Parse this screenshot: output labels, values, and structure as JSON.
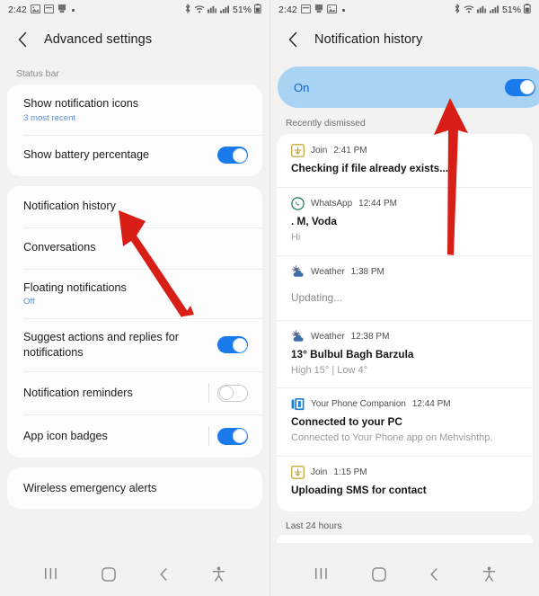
{
  "status_bar": {
    "time": "2:42",
    "left_icons": [
      "image-icon",
      "calendar-icon",
      "app-icon",
      "dot-icon"
    ],
    "right_icons": [
      "bluetooth-icon",
      "wifi-icon",
      "network-icon",
      "signal-icon"
    ],
    "battery_percent": "51%",
    "battery_icon": "battery-icon"
  },
  "colors": {
    "accent_blue": "#1a7aea",
    "banner_bg": "#a9d3f3",
    "banner_text": "#1565c0",
    "sub_blue": "#5a8fd6",
    "arrow_red": "#d81f17"
  },
  "left_screen": {
    "title": "Advanced settings",
    "back_icon": "back-chevron-icon",
    "section_label": "Status bar",
    "groups": [
      {
        "rows": [
          {
            "title": "Show notification icons",
            "sub": "3 most recent",
            "control": "none"
          },
          {
            "title": "Show battery percentage",
            "sub": "",
            "control": "toggle-on"
          }
        ]
      },
      {
        "rows": [
          {
            "title": "Notification history",
            "sub": "",
            "control": "none"
          },
          {
            "title": "Conversations",
            "sub": "",
            "control": "none"
          },
          {
            "title": "Floating notifications",
            "sub": "Off",
            "control": "none"
          },
          {
            "title": "Suggest actions and replies for notifications",
            "sub": "",
            "control": "toggle-on"
          },
          {
            "title": "Notification reminders",
            "sub": "",
            "control": "toggle-off-divider"
          },
          {
            "title": "App icon badges",
            "sub": "",
            "control": "toggle-on-divider"
          }
        ]
      },
      {
        "rows": [
          {
            "title": "Wireless emergency alerts",
            "sub": "",
            "control": "none"
          }
        ]
      }
    ]
  },
  "right_screen": {
    "title": "Notification history",
    "back_icon": "back-chevron-icon",
    "banner": {
      "label": "On",
      "toggle": "toggle-on"
    },
    "recent_label": "Recently dismissed",
    "notifications": [
      {
        "app": "Join",
        "app_icon": "join-icon",
        "time": "2:41 PM",
        "title": "Checking if file already exists...",
        "body": "",
        "title_style": "bold"
      },
      {
        "app": "WhatsApp",
        "app_icon": "whatsapp-icon",
        "time": "12:44 PM",
        "title": ". M, Voda",
        "body": "Hi",
        "title_style": "bold"
      },
      {
        "app": "Weather",
        "app_icon": "weather-icon",
        "time": "1:38 PM",
        "title": "Updating...",
        "body": "",
        "title_style": "plain"
      },
      {
        "app": "Weather",
        "app_icon": "weather-icon",
        "time": "12:38 PM",
        "title": "13° Bulbul Bagh Barzula",
        "body": "High 15° | Low 4°",
        "title_style": "bold"
      },
      {
        "app": "Your Phone Companion",
        "app_icon": "your-phone-companion-icon",
        "time": "12:44 PM",
        "title": "Connected to your PC",
        "body": "Connected to Your Phone app on Mehvishthp.",
        "title_style": "bold"
      },
      {
        "app": "Join",
        "app_icon": "join-icon",
        "time": "1:15 PM",
        "title": "Uploading SMS for contact",
        "body": "",
        "title_style": "bold"
      }
    ],
    "last_24_label": "Last 24 hours"
  },
  "nav_bar": {
    "recents_icon": "recents-icon",
    "home_icon": "home-icon",
    "back_icon": "back-chevron-icon",
    "accessibility_icon": "accessibility-icon"
  },
  "annotations": [
    {
      "name": "arrow-to-notification-history",
      "panel": "left"
    },
    {
      "name": "arrow-to-on-toggle",
      "panel": "right"
    }
  ]
}
